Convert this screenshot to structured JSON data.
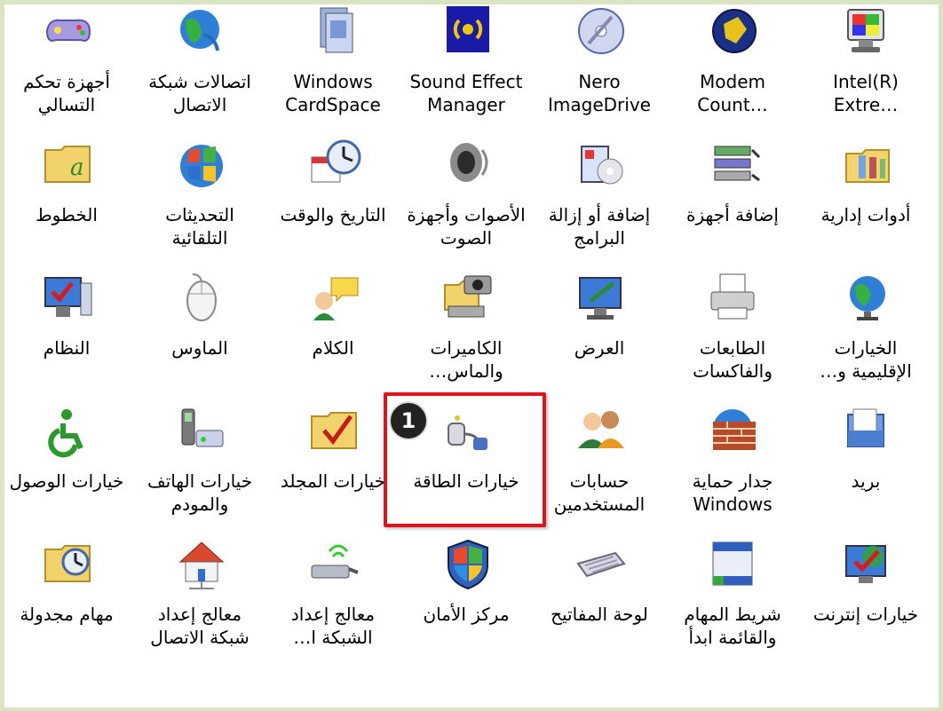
{
  "colors": {
    "highlight": "#e0121b",
    "badge": "#222222",
    "background": "#d8e4c2"
  },
  "callout": {
    "step": "1"
  },
  "rows": [
    {
      "items": [
        {
          "label": "Intel(R)\nExtre…",
          "icon": "intel-graphics-icon"
        },
        {
          "label": "Modem\nCount…",
          "icon": "modem-counter-icon"
        },
        {
          "label": "Nero\nImageDrive",
          "icon": "nero-disc-icon"
        },
        {
          "label": "Sound Effect\nManager",
          "icon": "sound-effect-icon"
        },
        {
          "label": "Windows\nCardSpace",
          "icon": "cardspace-icon"
        },
        {
          "label": "اتصالات شبكة\nالاتصال",
          "icon": "network-globe-icon"
        },
        {
          "label": "أجهزة تحكم\nالتسالي",
          "icon": "gamepad-icon"
        }
      ]
    },
    {
      "items": [
        {
          "label": "أدوات إدارية",
          "icon": "admin-tools-icon"
        },
        {
          "label": "إضافة أجهزة",
          "icon": "add-hardware-icon"
        },
        {
          "label": "إضافة أو إزالة\nالبرامج",
          "icon": "add-remove-programs-icon"
        },
        {
          "label": "الأصوات وأجهزة\nالصوت",
          "icon": "speaker-icon"
        },
        {
          "label": "التاريخ والوقت",
          "icon": "date-time-icon"
        },
        {
          "label": "التحديثات\nالتلقائية",
          "icon": "windows-update-icon"
        },
        {
          "label": "الخطوط",
          "icon": "fonts-folder-icon"
        }
      ]
    },
    {
      "items": [
        {
          "label": "الخيارات\n…الإقليمية و",
          "icon": "regional-globe-icon"
        },
        {
          "label": "الطابعات\nوالفاكسات",
          "icon": "printer-icon"
        },
        {
          "label": "العرض",
          "icon": "display-icon"
        },
        {
          "label": "الكاميرات\n…والماس",
          "icon": "scanner-camera-icon"
        },
        {
          "label": "الكلام",
          "icon": "speech-icon"
        },
        {
          "label": "الماوس",
          "icon": "mouse-icon"
        },
        {
          "label": "النظام",
          "icon": "system-icon"
        }
      ]
    },
    {
      "items": [
        {
          "label": "بريد",
          "icon": "mail-icon"
        },
        {
          "label": "جدار حماية\nWindows",
          "icon": "firewall-icon"
        },
        {
          "label": "حسابات\nالمستخدمين",
          "icon": "user-accounts-icon"
        },
        {
          "label": "خيارات الطاقة",
          "icon": "power-plug-icon"
        },
        {
          "label": "خيارات المجلد",
          "icon": "folder-options-icon"
        },
        {
          "label": "خيارات الهاتف\nوالمودم",
          "icon": "phone-modem-icon"
        },
        {
          "label": "خيارات الوصول",
          "icon": "accessibility-icon"
        }
      ]
    },
    {
      "items": [
        {
          "label": "خيارات إنترنت",
          "icon": "internet-options-icon"
        },
        {
          "label": "شريط المهام\nوالقائمة ابدأ",
          "icon": "taskbar-icon"
        },
        {
          "label": "لوحة المفاتيح",
          "icon": "keyboard-icon"
        },
        {
          "label": "مركز الأمان",
          "icon": "security-shield-icon"
        },
        {
          "label": "معالج إعداد\n…الشبكة ا",
          "icon": "wireless-network-icon"
        },
        {
          "label": "معالج إعداد\nشبكة الاتصال",
          "icon": "network-house-icon"
        },
        {
          "label": "مهام مجدولة",
          "icon": "scheduled-tasks-icon"
        }
      ]
    }
  ]
}
